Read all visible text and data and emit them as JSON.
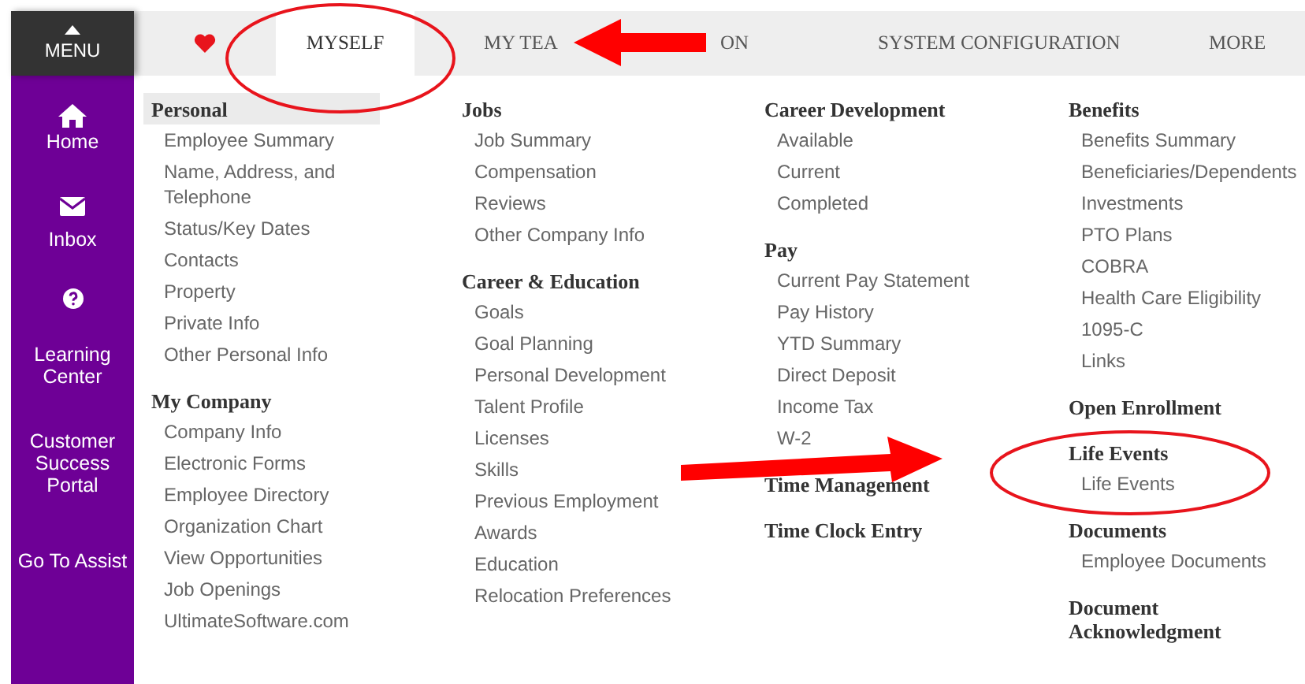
{
  "menu_button": {
    "label": "MENU"
  },
  "tabs": [
    {
      "kind": "icon",
      "selected": false
    },
    {
      "kind": "text",
      "label": "MYSELF",
      "selected": true
    },
    {
      "kind": "text",
      "label": "MY TEA",
      "selected": false
    },
    {
      "kind": "text",
      "label": "ON",
      "selected": false
    },
    {
      "kind": "text",
      "label": "SYSTEM CONFIGURATION",
      "selected": false
    },
    {
      "kind": "text",
      "label": "MORE",
      "selected": false
    }
  ],
  "sidebar": {
    "items": [
      {
        "kind": "home",
        "label": "Home"
      },
      {
        "kind": "inbox",
        "label": "Inbox"
      },
      {
        "kind": "help",
        "label": "Learning Center"
      },
      {
        "kind": "plain",
        "label": "Customer Success Portal"
      },
      {
        "kind": "plain",
        "label": "Go To Assist"
      }
    ]
  },
  "columns": [
    {
      "groups": [
        {
          "title": "Personal",
          "selected": true,
          "items": [
            "Employee Summary",
            "Name, Address, and Telephone",
            "Status/Key Dates",
            "Contacts",
            "Property",
            "Private Info",
            "Other Personal Info"
          ]
        },
        {
          "title": "My Company",
          "selected": false,
          "items": [
            "Company Info",
            "Electronic Forms",
            "Employee Directory",
            "Organization Chart",
            "View Opportunities",
            "Job Openings",
            "UltimateSoftware.com"
          ]
        }
      ]
    },
    {
      "groups": [
        {
          "title": "Jobs",
          "selected": false,
          "items": [
            "Job Summary",
            "Compensation",
            "Reviews",
            "Other Company Info"
          ]
        },
        {
          "title": "Career & Education",
          "selected": false,
          "items": [
            "Goals",
            "Goal Planning",
            "Personal Development",
            "Talent Profile",
            "Licenses",
            "Skills",
            "Previous Employment",
            "Awards",
            "Education",
            "Relocation Preferences"
          ]
        }
      ]
    },
    {
      "groups": [
        {
          "title": "Career Development",
          "selected": false,
          "items": [
            "Available",
            "Current",
            "Completed"
          ]
        },
        {
          "title": "Pay",
          "selected": false,
          "items": [
            "Current Pay Statement",
            "Pay History",
            "YTD Summary",
            "Direct Deposit",
            "Income Tax",
            "W-2"
          ]
        },
        {
          "title": "Time Management",
          "selected": false
        },
        {
          "title": "Time Clock Entry",
          "selected": false
        }
      ]
    },
    {
      "groups": [
        {
          "title": "Benefits",
          "selected": false,
          "items": [
            "Benefits Summary",
            "Beneficiaries/Dependents",
            "Investments",
            "PTO Plans",
            "COBRA",
            "Health Care Eligibility",
            "1095-C",
            "Links"
          ]
        },
        {
          "title": "Open Enrollment",
          "selected": false
        },
        {
          "title": "Life Events",
          "selected": false,
          "items": [
            "Life Events"
          ]
        },
        {
          "title": "Documents",
          "selected": false,
          "items": [
            "Employee Documents"
          ]
        },
        {
          "title": "Document Acknowledgment",
          "selected": false
        }
      ]
    }
  ]
}
